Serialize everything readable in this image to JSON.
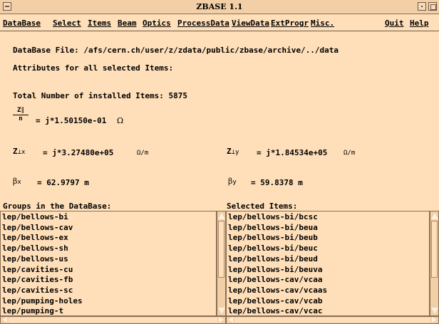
{
  "window": {
    "title": "ZBASE 1.1"
  },
  "menu": {
    "database": "DataBase",
    "select": "Select",
    "items": "Items",
    "beam": "Beam",
    "optics": "Optics",
    "processdata": "ProcessData",
    "viewdata": "ViewData",
    "extprogr": "ExtProgr",
    "misc": "Misc.",
    "quit": "Quit",
    "help": "Help"
  },
  "info": {
    "database_file": "DataBase File: /afs/cern.ch/user/z/zdata/public/zbase/archive/../data",
    "attributes": "Attributes for all selected Items:",
    "total_items": "Total Number of installed Items: 5875"
  },
  "impedance": {
    "longitudinal": {
      "num": "Z",
      "num_sub": "∥",
      "den": "n",
      "value": "= j*1.50150e-01",
      "unit": "Ω"
    },
    "transverse_x": {
      "symbol": "Z",
      "sub": "⊥x",
      "value": "= j*3.27480e+05",
      "unit": "Ω/m"
    },
    "transverse_y": {
      "symbol": "Z",
      "sub": "⊥y",
      "value": "= j*1.84534e+05",
      "unit": "Ω/m"
    }
  },
  "beta": {
    "x": {
      "symbol": "β",
      "sub": "x",
      "value": "= 62.9797 m"
    },
    "y": {
      "symbol": "β",
      "sub": "y",
      "value": "= 59.8378 m"
    }
  },
  "groups": {
    "label": "Groups in the DataBase:",
    "items": [
      "lep/bellows-bi",
      "lep/bellows-cav",
      "lep/bellows-ex",
      "lep/bellows-sh",
      "lep/bellows-us",
      "lep/cavities-cu",
      "lep/cavities-fb",
      "lep/cavities-sc",
      "lep/pumping-holes",
      "lep/pumping-t"
    ]
  },
  "selected": {
    "label": "Selected Items:",
    "items": [
      "lep/bellows-bi/bcsc",
      "lep/bellows-bi/beua",
      "lep/bellows-bi/beub",
      "lep/bellows-bi/beuc",
      "lep/bellows-bi/beud",
      "lep/bellows-bi/beuva",
      "lep/bellows-cav/vcaa",
      "lep/bellows-cav/vcaas",
      "lep/bellows-cav/vcab",
      "lep/bellows-cav/vcac"
    ]
  },
  "colors": {
    "background": "#ffdfb9",
    "titlebar": "#f2cfa6",
    "border": "#8a6f55"
  }
}
